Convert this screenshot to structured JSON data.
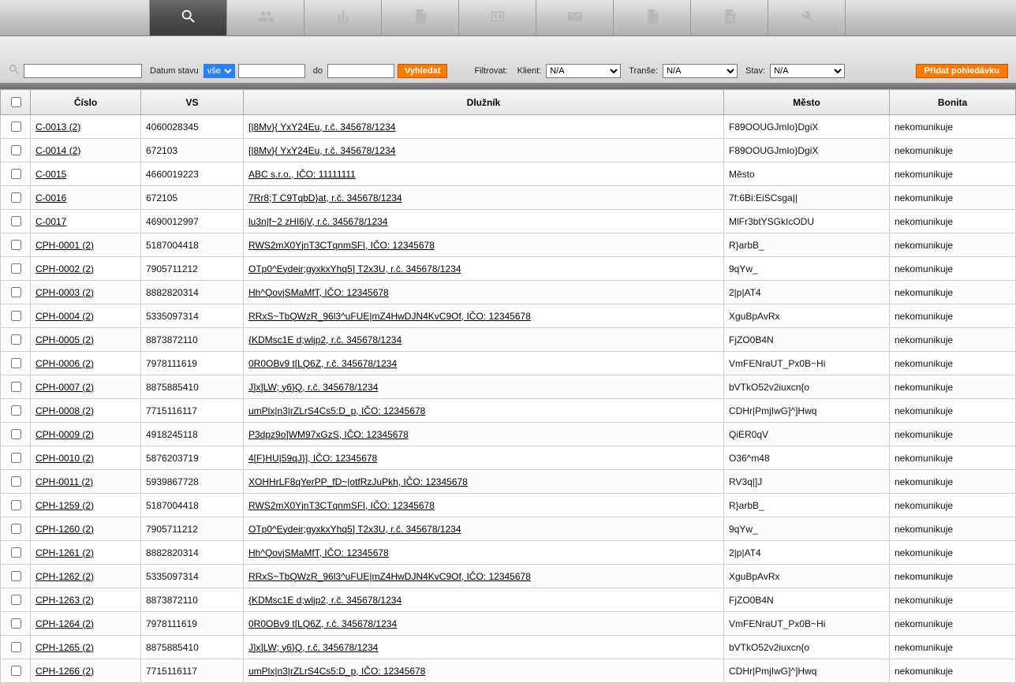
{
  "nav": {
    "tabs": [
      "spacer",
      "search",
      "users",
      "stats",
      "doc",
      "card",
      "mail",
      "doc-plus",
      "doc-search",
      "tools"
    ],
    "active_index": 1
  },
  "filter": {
    "search_value": "",
    "datum_stavu_label": "Datum stavu",
    "vse_option": "vše",
    "date_from_value": "",
    "do_label": "do",
    "date_to_value": "",
    "search_btn": "Vyhledat",
    "filtrovat_label": "Filtrovat:",
    "klient_label": "Klient:",
    "klient_value": "N/A",
    "transe_label": "Tranše:",
    "transe_value": "N/A",
    "stav_label": "Stav:",
    "stav_value": "N/A",
    "add_btn": "Přidat pohledávku"
  },
  "columns": {
    "cislo": "Číslo",
    "vs": "VS",
    "dluznik": "Dlužník",
    "mesto": "Město",
    "bonita": "Bonita"
  },
  "rows": [
    {
      "cislo": "C-0013 (2)",
      "vs": "4060028345",
      "dluznik": "[|8Mv}{ YxY24Eu, r.č. 345678/1234",
      "mesto": "F89OOUGJmIo}DgiX",
      "bonita": "nekomunikuje"
    },
    {
      "cislo": "C-0014 (2)",
      "vs": "672103",
      "dluznik": "[|8Mv}{ YxY24Eu, r.č. 345678/1234",
      "mesto": "F89OOUGJmIo}DgiX",
      "bonita": "nekomunikuje"
    },
    {
      "cislo": "C-0015",
      "vs": "4660019223",
      "dluznik": "ABC s.r.o., IČO: 11111111",
      "mesto": "Město",
      "bonita": "nekomunikuje"
    },
    {
      "cislo": "C-0016",
      "vs": "672105",
      "dluznik": "7Rr8;T C9TqbD}at, r.č. 345678/1234",
      "mesto": "7f:6Bi:EiSCsga||",
      "bonita": "nekomunikuje"
    },
    {
      "cislo": "C-0017",
      "vs": "4690012997",
      "dluznik": "lu3n|f~2 zHI6jV, r.č. 345678/1234",
      "mesto": "MlFr3btYSGkIcODU",
      "bonita": "nekomunikuje"
    },
    {
      "cislo": "CPH-0001 (2)",
      "vs": "5187004418",
      "dluznik": "RWS2mX0YjnT3CTqnmSFl, IČO: 12345678",
      "mesto": "R}arbB_",
      "bonita": "nekomunikuje"
    },
    {
      "cislo": "CPH-0002 (2)",
      "vs": "7905711212",
      "dluznik": "OTp0^Eydeir;gyxkxYhq5] T2x3U, r.č. 345678/1234",
      "mesto": "9qYw_",
      "bonita": "nekomunikuje"
    },
    {
      "cislo": "CPH-0003 (2)",
      "vs": "8882820314",
      "dluznik": "Hh^QovjSMaMfT, IČO: 12345678",
      "mesto": "2|p|AT4",
      "bonita": "nekomunikuje"
    },
    {
      "cislo": "CPH-0004 (2)",
      "vs": "5335097314",
      "dluznik": "RRxS~TbQWzR_96l3^uFUE|mZ4HwDJN4KvC9Of, IČO: 12345678",
      "mesto": "XguBpAvRx",
      "bonita": "nekomunikuje"
    },
    {
      "cislo": "CPH-0005 (2)",
      "vs": "8873872110",
      "dluznik": "{KDMsc1E d;wljp2, r.č. 345678/1234",
      "mesto": "FjZO0B4N",
      "bonita": "nekomunikuje"
    },
    {
      "cislo": "CPH-0006 (2)",
      "vs": "7978111619",
      "dluznik": "0R0OBv9 t[LQ6Z, r.č. 345678/1234",
      "mesto": "VmFENraUT_Px0B~Hi",
      "bonita": "nekomunikuje"
    },
    {
      "cislo": "CPH-0007 (2)",
      "vs": "8875885410",
      "dluznik": "J]x]LW; y6}Q, r.č. 345678/1234",
      "mesto": "bVTkO52v2iuxcn{o",
      "bonita": "nekomunikuje"
    },
    {
      "cislo": "CPH-0008 (2)",
      "vs": "7715116117",
      "dluznik": "umPlx|n3|rZLrS4Cs5:D_p, IČO: 12345678",
      "mesto": "CDHr|PmjIwG]^]Hwq",
      "bonita": "nekomunikuje"
    },
    {
      "cislo": "CPH-0009 (2)",
      "vs": "4918245118",
      "dluznik": "P3dpz9o]WM97xGzS, IČO: 12345678",
      "mesto": "QiER0qV",
      "bonita": "nekomunikuje"
    },
    {
      "cislo": "CPH-0010 (2)",
      "vs": "5876203719",
      "dluznik": "4[F}HU|59qJ}], IČO: 12345678",
      "mesto": "O36^m48",
      "bonita": "nekomunikuje"
    },
    {
      "cislo": "CPH-0011 (2)",
      "vs": "5939867728",
      "dluznik": "XOHHrLF8qYerPP_fD~|otfRzJuPkh, IČO: 12345678",
      "mesto": "RV3q|]J",
      "bonita": "nekomunikuje"
    },
    {
      "cislo": "CPH-1259 (2)",
      "vs": "5187004418",
      "dluznik": "RWS2mX0YjnT3CTqnmSFl, IČO: 12345678",
      "mesto": "R}arbB_",
      "bonita": "nekomunikuje"
    },
    {
      "cislo": "CPH-1260 (2)",
      "vs": "7905711212",
      "dluznik": "OTp0^Eydeir;gyxkxYhq5] T2x3U, r.č. 345678/1234",
      "mesto": "9qYw_",
      "bonita": "nekomunikuje"
    },
    {
      "cislo": "CPH-1261 (2)",
      "vs": "8882820314",
      "dluznik": "Hh^QovjSMaMfT, IČO: 12345678",
      "mesto": "2|p|AT4",
      "bonita": "nekomunikuje"
    },
    {
      "cislo": "CPH-1262 (2)",
      "vs": "5335097314",
      "dluznik": "RRxS~TbQWzR_96l3^uFUE|mZ4HwDJN4KvC9Of, IČO: 12345678",
      "mesto": "XguBpAvRx",
      "bonita": "nekomunikuje"
    },
    {
      "cislo": "CPH-1263 (2)",
      "vs": "8873872110",
      "dluznik": "{KDMsc1E d;wljp2, r.č. 345678/1234",
      "mesto": "FjZO0B4N",
      "bonita": "nekomunikuje"
    },
    {
      "cislo": "CPH-1264 (2)",
      "vs": "7978111619",
      "dluznik": "0R0OBv9 t[LQ6Z, r.č. 345678/1234",
      "mesto": "VmFENraUT_Px0B~Hi",
      "bonita": "nekomunikuje"
    },
    {
      "cislo": "CPH-1265 (2)",
      "vs": "8875885410",
      "dluznik": "J]x]LW; y6}Q, r.č. 345678/1234",
      "mesto": "bVTkO52v2iuxcn{o",
      "bonita": "nekomunikuje"
    },
    {
      "cislo": "CPH-1266 (2)",
      "vs": "7715116117",
      "dluznik": "umPlx|n3|rZLrS4Cs5:D_p, IČO: 12345678",
      "mesto": "CDHr|PmjIwG]^]Hwq",
      "bonita": "nekomunikuje"
    }
  ]
}
